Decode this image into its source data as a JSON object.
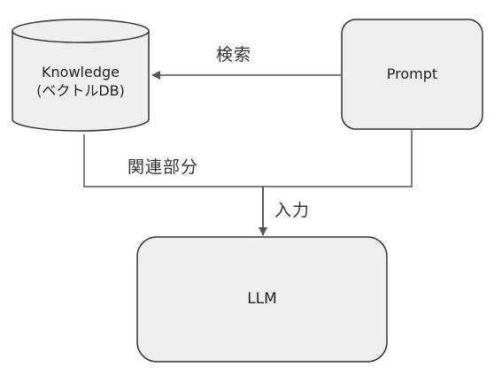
{
  "nodes": {
    "knowledge": {
      "line1": "Knowledge",
      "line2": "(ベクトルDB)",
      "shape": "cylinder",
      "fill": "#eeeeee",
      "stroke": "#333333"
    },
    "prompt": {
      "label": "Prompt",
      "shape": "rounded-rectangle",
      "fill": "#eeeeee",
      "stroke": "#333333"
    },
    "llm": {
      "label": "LLM",
      "shape": "rounded-rectangle",
      "fill": "#eeeeee",
      "stroke": "#333333"
    }
  },
  "edges": {
    "search": {
      "label": "検索",
      "from": "prompt",
      "to": "knowledge"
    },
    "related": {
      "label": "関連部分",
      "from": [
        "knowledge",
        "prompt"
      ],
      "to": "llm"
    },
    "input": {
      "label": "入力",
      "from": "merge-point",
      "to": "llm"
    }
  },
  "colors": {
    "line": "#555555",
    "box_fill": "#eeeeee",
    "box_stroke": "#333333"
  }
}
